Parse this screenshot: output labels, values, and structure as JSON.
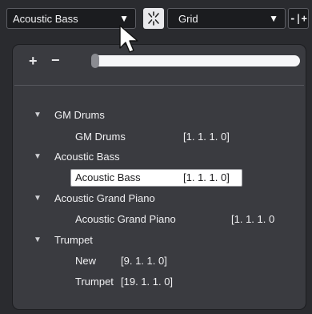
{
  "toolbar": {
    "track_select": {
      "value": "Acoustic Bass",
      "arrow": "▼"
    },
    "snap_toggle": {
      "icon": "snap-icon"
    },
    "grid_select": {
      "value": "Grid",
      "arrow": "▼"
    },
    "quantize_button": {
      "label": "-|+"
    }
  },
  "panel": {
    "add_label": "+",
    "remove_label": "−",
    "zoom_slider_level": 0.0,
    "groups": [
      {
        "label": "GM Drums",
        "expanded": true,
        "items": [
          {
            "name": "GM Drums",
            "position": "[1. 1. 1.  0]",
            "selected": false
          }
        ]
      },
      {
        "label": "Acoustic Bass",
        "expanded": true,
        "items": [
          {
            "name": "Acoustic Bass",
            "position": "[1. 1. 1.  0]",
            "selected": true
          }
        ]
      },
      {
        "label": "Acoustic Grand Piano",
        "expanded": true,
        "items": [
          {
            "name": "Acoustic Grand Piano",
            "position": "[1. 1. 1.  0",
            "selected": false
          }
        ]
      },
      {
        "label": "Trumpet",
        "expanded": true,
        "items": [
          {
            "name": "New",
            "position": "[9. 1. 1.  0]",
            "selected": false
          },
          {
            "name": "Trumpet",
            "position": "[19. 1. 1.  0]",
            "selected": false
          }
        ]
      }
    ]
  },
  "colors": {
    "background": "#2a2b2f",
    "panel": "#3a3b40",
    "selection": "#ffffff"
  }
}
